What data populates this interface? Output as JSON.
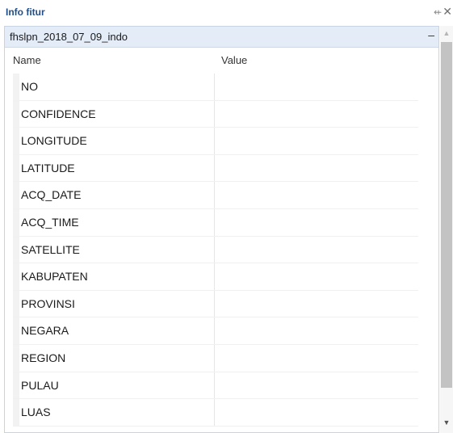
{
  "window": {
    "title": "Info fitur",
    "pin_icon": "⇷",
    "close_icon": "✕"
  },
  "layer": {
    "name": "fhslpn_2018_07_09_indo",
    "collapse_icon": "–"
  },
  "columns": {
    "name": "Name",
    "value": "Value"
  },
  "fields": [
    {
      "name": "NO",
      "value": ""
    },
    {
      "name": "CONFIDENCE",
      "value": ""
    },
    {
      "name": "LONGITUDE",
      "value": ""
    },
    {
      "name": "LATITUDE",
      "value": ""
    },
    {
      "name": "ACQ_DATE",
      "value": ""
    },
    {
      "name": "ACQ_TIME",
      "value": ""
    },
    {
      "name": "SATELLITE",
      "value": ""
    },
    {
      "name": "KABUPATEN",
      "value": ""
    },
    {
      "name": "PROVINSI",
      "value": ""
    },
    {
      "name": "NEGARA",
      "value": ""
    },
    {
      "name": "REGION",
      "value": ""
    },
    {
      "name": "PULAU",
      "value": ""
    },
    {
      "name": "LUAS",
      "value": ""
    }
  ],
  "scrollbar": {
    "up_icon": "▲",
    "down_icon": "▼"
  },
  "colors": {
    "title": "#1f4e8c",
    "layer_header_bg": "#e4ecf7",
    "scroll_thumb": "#c3c3c3"
  }
}
